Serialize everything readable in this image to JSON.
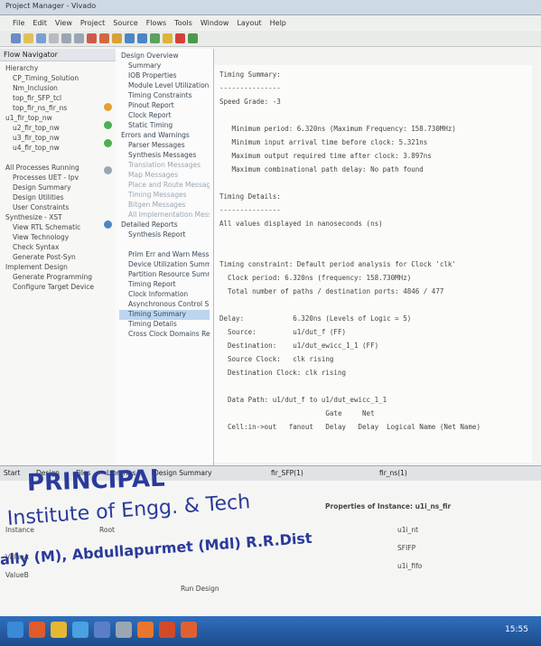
{
  "titlebar": {
    "title": "Project Manager - Vivado"
  },
  "menu": [
    "File",
    "Edit",
    "View",
    "Project",
    "Source",
    "Flows",
    "Tools",
    "Window",
    "Layout",
    "Help"
  ],
  "left": {
    "header": "Flow Navigator",
    "tree": [
      "Hierarchy",
      "CP_Timing_Solution",
      "Nm_Inclusion",
      "top_fir_SFP_tcl",
      "top_fir_ns_fir_ns",
      "u1_fir_top_nw",
      "u2_fir_top_nw",
      "u3_fir_top_nw",
      "u4_fir_top_nw",
      "",
      "All Processes Running",
      "Processes UET - Ipv",
      "Design Summary",
      "Design Utilities",
      "User Constraints",
      "Synthesize - XST",
      "View RTL Schematic",
      "View Technology",
      "Check Syntax",
      "Generate Post-Syn",
      "Implement Design",
      "Generate Programming",
      "Configure Target Device"
    ]
  },
  "mid": {
    "items": [
      "Design Overview",
      "Summary",
      "IOB Properties",
      "Module Level Utilization",
      "Timing Constraints",
      "Pinout Report",
      "Clock Report",
      "Static Timing",
      "Errors and Warnings",
      "Parser Messages",
      "Synthesis Messages",
      "Translation Messages",
      "Map Messages",
      "Place and Route Messages",
      "Timing Messages",
      "Bitgen Messages",
      "All Implementation Messages",
      "Detailed Reports",
      "Synthesis Report",
      "",
      "Prim Err and Warn Messages",
      "Device Utilization Summary",
      "Partition Resource Summary",
      "Timing Report",
      "Clock Information",
      "Asynchronous Control Signals",
      "Timing Summary",
      "Timing Details",
      "Cross Clock Domains Report"
    ],
    "selected_index": 26
  },
  "report": {
    "lines": [
      "Timing Summary:",
      "---------------",
      "Speed Grade: -3",
      "",
      "   Minimum period: 6.320ns (Maximum Frequency: 158.730MHz)",
      "   Minimum input arrival time before clock: 5.321ns",
      "   Maximum output required time after clock: 3.897ns",
      "   Maximum combinational path delay: No path found",
      "",
      "Timing Details:",
      "---------------",
      "All values displayed in nanoseconds (ns)",
      "",
      "",
      "Timing constraint: Default period analysis for Clock 'clk'",
      "  Clock period: 6.320ns (frequency: 158.730MHz)",
      "  Total number of paths / destination ports: 4846 / 477",
      "",
      "Delay:            6.320ns (Levels of Logic = 5)",
      "  Source:         u1/dut_f (FF)",
      "  Destination:    u1/dut_ewicc_1_1 (FF)",
      "  Source Clock:   clk rising",
      "  Destination Clock: clk rising",
      "",
      "  Data Path: u1/dut_f to u1/dut_ewicc_1_1",
      "                          Gate     Net",
      "  Cell:in->out   fanout   Delay   Delay  Logical Name (Net Name)"
    ]
  },
  "tabs": [
    "Start",
    "Design",
    "Files",
    "Libraries",
    "Design Summary",
    "fir_SFP(1)",
    "fir_ns(1)"
  ],
  "bottom": {
    "panel_title": "Properties of Instance: u1i_ns_fir",
    "labels": [
      "Instance",
      "Root",
      "ValueA",
      "ValueB"
    ],
    "values": [
      "u1i_nt",
      "SFIFP",
      "u1i_fifo"
    ],
    "stamp_line1": "PRINCIPAL",
    "stamp_line2": "Institute of Engg. & Tech",
    "stamp_line3": "ally (M), Abdullapurmet (Mdl) R.R.Dist",
    "footer_hint": "Run Design"
  },
  "taskbar": {
    "clock": "15:55"
  },
  "colors": {
    "accent": "#1d4c8c",
    "stamp": "#2a3a9a",
    "selection": "#bcd6ef"
  }
}
